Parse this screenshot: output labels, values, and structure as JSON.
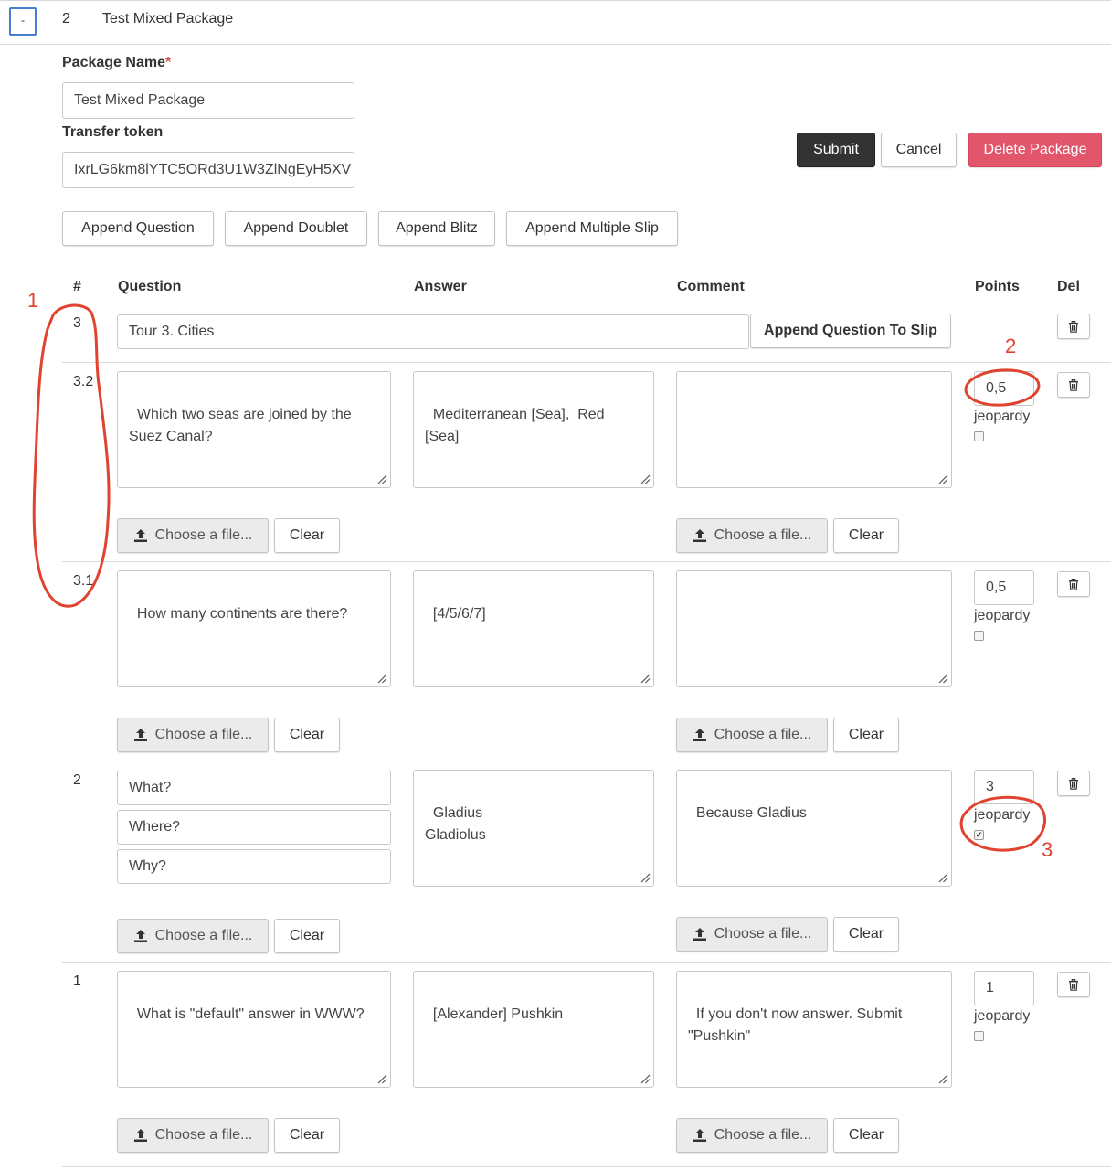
{
  "header": {
    "collapse_label": "-",
    "package_number": "2",
    "package_title": "Test Mixed Package"
  },
  "form": {
    "package_name_label": "Package Name",
    "required_marker": "*",
    "package_name_value": "Test Mixed Package",
    "transfer_token_label": "Transfer token",
    "transfer_token_value": "IxrLG6km8lYTC5ORd3U1W3ZlNgEyH5XV"
  },
  "actions": {
    "submit": "Submit",
    "cancel": "Cancel",
    "delete": "Delete Package"
  },
  "append_buttons": [
    "Append Question",
    "Append Doublet",
    "Append Blitz",
    "Append Multiple Slip"
  ],
  "columns": {
    "num": "#",
    "question": "Question",
    "answer": "Answer",
    "comment": "Comment",
    "points": "Points",
    "del": "Del"
  },
  "slip": {
    "number": "3",
    "title": "Tour 3. Cities",
    "append_label": "Append Question To Slip"
  },
  "file_buttons": {
    "choose": "Choose a file...",
    "clear": "Clear"
  },
  "jeopardy_label": "jeopardy",
  "rows": [
    {
      "number": "3.2",
      "question": "Which two seas are joined by the Suez Canal?",
      "answer": "Mediterranean [Sea],  Red [Sea]",
      "comment": "",
      "points": "0,5",
      "jeopardy": false
    },
    {
      "number": "3.1",
      "question": "How many continents are there?",
      "answer": "[4/5/6/7]",
      "comment": "",
      "points": "0,5",
      "jeopardy": false
    },
    {
      "number": "2",
      "questions": [
        "What?",
        "Where?",
        "Why?"
      ],
      "answer": "Gladius\nGladiolus",
      "comment": "Because Gladius",
      "points": "3",
      "jeopardy": true
    },
    {
      "number": "1",
      "question": "What is \"default\" answer in WWW?",
      "answer": "[Alexander] Pushkin",
      "comment": "If you don't now answer. Submit \"Pushkin\"",
      "points": "1",
      "jeopardy": false
    }
  ],
  "annotations": [
    "1",
    "2",
    "3"
  ],
  "colors": {
    "annotation": "#e0432f",
    "delete_button": "#e2566b",
    "submit_button": "#333333",
    "focus_border": "#4a7fd0"
  }
}
